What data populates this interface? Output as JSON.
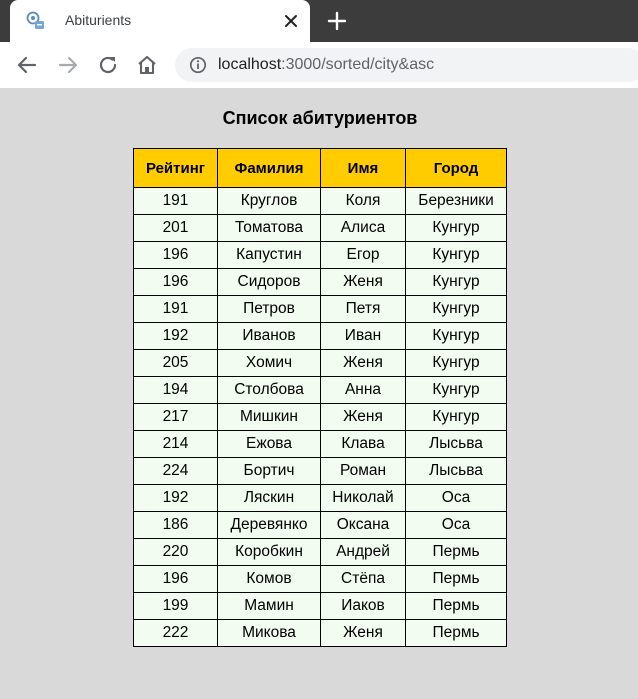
{
  "browser": {
    "tab_title": "Abiturients",
    "url_host": "localhost",
    "url_rest": ":3000/sorted/city&asc"
  },
  "page": {
    "title": "Список абитуриентов"
  },
  "table": {
    "headers": [
      "Рейтинг",
      "Фамилия",
      "Имя",
      "Город"
    ],
    "rows": [
      [
        "191",
        "Круглов",
        "Коля",
        "Березники"
      ],
      [
        "201",
        "Томатова",
        "Алиса",
        "Кунгур"
      ],
      [
        "196",
        "Капустин",
        "Егор",
        "Кунгур"
      ],
      [
        "196",
        "Сидоров",
        "Женя",
        "Кунгур"
      ],
      [
        "191",
        "Петров",
        "Петя",
        "Кунгур"
      ],
      [
        "192",
        "Иванов",
        "Иван",
        "Кунгур"
      ],
      [
        "205",
        "Хомич",
        "Женя",
        "Кунгур"
      ],
      [
        "194",
        "Столбова",
        "Анна",
        "Кунгур"
      ],
      [
        "217",
        "Мишкин",
        "Женя",
        "Кунгур"
      ],
      [
        "214",
        "Ежова",
        "Клава",
        "Лысьва"
      ],
      [
        "224",
        "Бортич",
        "Роман",
        "Лысьва"
      ],
      [
        "192",
        "Ляскин",
        "Николай",
        "Оса"
      ],
      [
        "186",
        "Деревянко",
        "Оксана",
        "Оса"
      ],
      [
        "220",
        "Коробкин",
        "Андрей",
        "Пермь"
      ],
      [
        "196",
        "Комов",
        "Стёпа",
        "Пермь"
      ],
      [
        "199",
        "Мамин",
        "Иаков",
        "Пермь"
      ],
      [
        "222",
        "Микова",
        "Женя",
        "Пермь"
      ]
    ]
  },
  "icons": {
    "favicon": "app-favicon-icon",
    "close": "close-icon",
    "new_tab": "plus-icon",
    "back": "back-arrow-icon",
    "forward": "forward-arrow-icon",
    "reload": "reload-icon",
    "home": "home-icon",
    "site_info": "info-icon"
  },
  "colors": {
    "header_bg": "#ffcc00",
    "cell_bg": "#f2fcf0",
    "page_bg": "#d9d9d9",
    "tabbar_bg": "#3c3c3c"
  }
}
